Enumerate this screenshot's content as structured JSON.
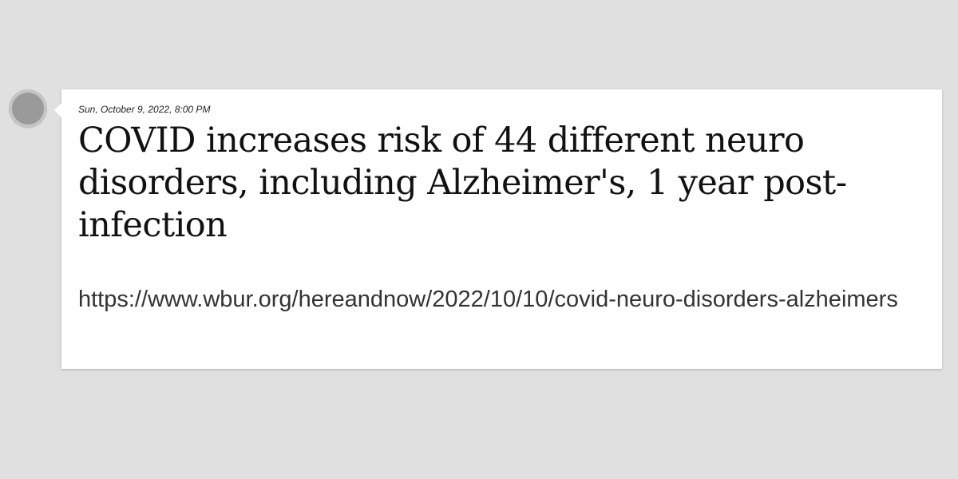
{
  "post": {
    "timestamp": "Sun, October 9, 2022, 8:00 PM",
    "headline": "COVID increases risk of 44 different neuro disorders, including Alzheimer's, 1 year post-infection",
    "url": "https://www.wbur.org/hereandnow/2022/10/10/covid-neuro-disorders-alzheimers"
  },
  "colors": {
    "background": "#e0e0e0",
    "card": "#ffffff",
    "avatar": "#9a9a9a"
  }
}
